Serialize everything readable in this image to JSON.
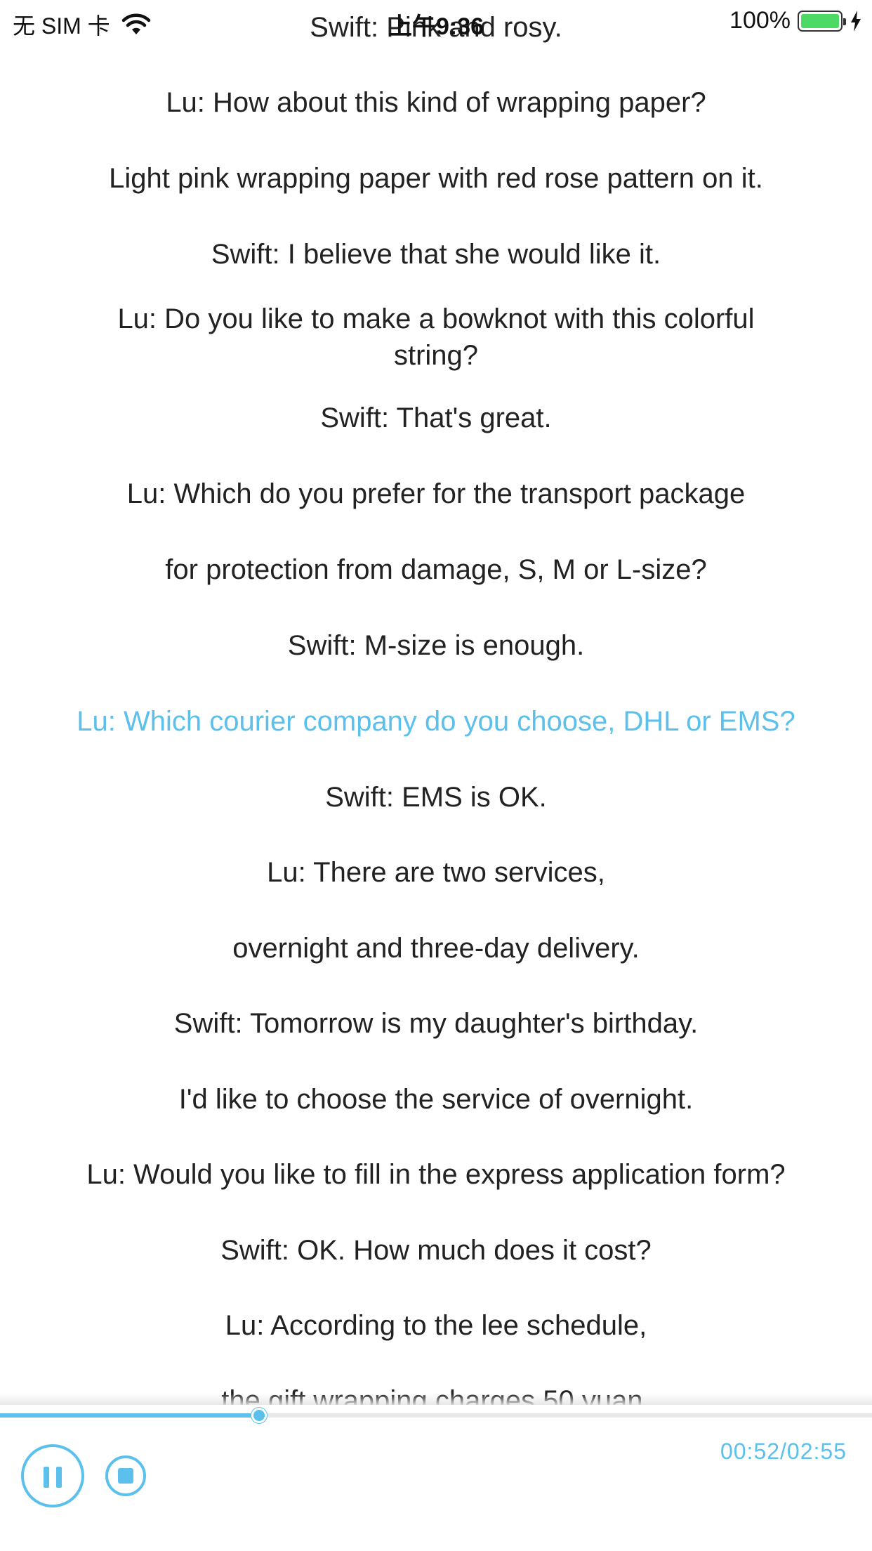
{
  "status_bar": {
    "carrier": "无 SIM 卡",
    "time": "上午9:36",
    "battery": "100%",
    "battery_level": 1.0,
    "icons": [
      "wifi-icon",
      "battery-icon",
      "charging-bolt-icon"
    ]
  },
  "lyrics": [
    {
      "text": "Swift: Pink and rosy.",
      "active": false
    },
    {
      "text": "Lu: How about this kind of wrapping paper?",
      "active": false
    },
    {
      "text": "Light pink wrapping paper with red rose pattern on it.",
      "active": false
    },
    {
      "text": "Swift: I believe that she would like it.",
      "active": false
    },
    {
      "text": "Lu: Do you like to make a bowknot with this colorful string?",
      "active": false
    },
    {
      "text": "Swift: That's great.",
      "active": false
    },
    {
      "text": "Lu: Which do you prefer for the transport package",
      "active": false
    },
    {
      "text": "for protection from damage, S, M or L-size?",
      "active": false
    },
    {
      "text": "Swift: M-size is enough.",
      "active": false
    },
    {
      "text": "Lu: Which courier company do you choose, DHL or EMS?",
      "active": true
    },
    {
      "text": "Swift: EMS is OK.",
      "active": false
    },
    {
      "text": "Lu: There are two services,",
      "active": false
    },
    {
      "text": "overnight and three-day delivery.",
      "active": false
    },
    {
      "text": "Swift: Tomorrow is my daughter's birthday.",
      "active": false
    },
    {
      "text": "I'd like to choose the service of overnight.",
      "active": false
    },
    {
      "text": "Lu: Would you like to fill in the express application form?",
      "active": false
    },
    {
      "text": "Swift: OK. How much does it cost?",
      "active": false
    },
    {
      "text": "Lu: According to the lee schedule,",
      "active": false
    },
    {
      "text": "the gift wrapping charges 50 yuan.",
      "active": false
    }
  ],
  "player": {
    "time_readout": "00:52/02:55",
    "progress": 0.297,
    "accent_color": "#5bc0eb",
    "pause_icon": "pause-icon",
    "stop_icon": "stop-icon"
  }
}
